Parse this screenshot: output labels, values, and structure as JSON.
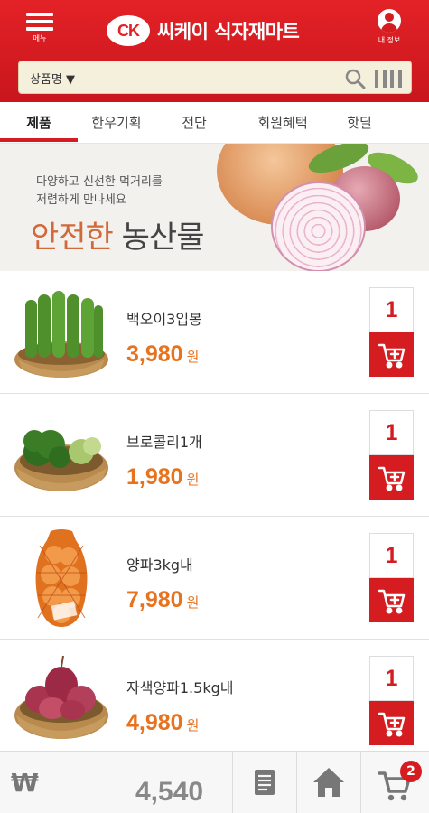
{
  "header": {
    "menu_label": "메뉴",
    "logo_badge": "CK",
    "title": "씨케이 식자재마트",
    "user_label": "내 정보"
  },
  "search": {
    "select_value": "상품명 ▼"
  },
  "tabs": [
    {
      "label": "제품",
      "active": true
    },
    {
      "label": "한우기획"
    },
    {
      "label": "전단"
    },
    {
      "label": "회원혜택"
    },
    {
      "label": "핫딜"
    }
  ],
  "banner": {
    "line1": "다양하고 신선한 먹거리를",
    "line2": "저렴하게 만나세요",
    "highlight": "안전한",
    "main": " 농산물"
  },
  "products": [
    {
      "name": "백오이3입봉",
      "price": "3,980",
      "unit": "원",
      "qty": "1"
    },
    {
      "name": "브로콜리1개",
      "price": "1,980",
      "unit": "원",
      "qty": "1"
    },
    {
      "name": "양파3kg내",
      "price": "7,980",
      "unit": "원",
      "qty": "1"
    },
    {
      "name": "자색양파1.5kg내",
      "price": "4,980",
      "unit": "원",
      "qty": "1"
    }
  ],
  "bottom": {
    "currency": "₩",
    "total": "4,540",
    "cart_count": "2"
  },
  "colors": {
    "brand_red": "#d41c21",
    "price_orange": "#e8731f"
  }
}
